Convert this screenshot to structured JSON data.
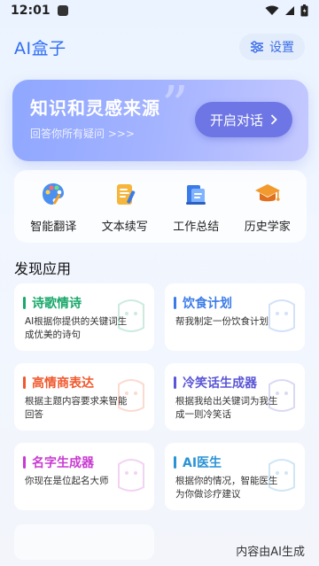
{
  "status_bar": {
    "time": "12:01"
  },
  "header": {
    "title": "AI盒子",
    "settings_label": "设置"
  },
  "hero": {
    "title": "知识和灵感来源",
    "subtitle": "回答你所有疑问 >>>",
    "quote_mark": "”",
    "button_label": "开启对话"
  },
  "features": [
    {
      "label": "智能翻译",
      "icon": "palette-icon"
    },
    {
      "label": "文本续写",
      "icon": "notepad-icon"
    },
    {
      "label": "工作总结",
      "icon": "document-icon"
    },
    {
      "label": "历史学家",
      "icon": "graduation-cap-icon"
    }
  ],
  "section_title": "发现应用",
  "apps": [
    {
      "title": "诗歌情诗",
      "desc": "AI根据你提供的关键词生成优美的诗句",
      "color": "#1aa86b"
    },
    {
      "title": "饮食计划",
      "desc": "帮我制定一份饮食计划",
      "color": "#3a7be8"
    },
    {
      "title": "高情商表达",
      "desc": "根据主题内容要求来智能回答",
      "color": "#f0592e"
    },
    {
      "title": "冷笑话生成器",
      "desc": "根据我给出关键词为我生成一则冷笑话",
      "color": "#5a56d6"
    },
    {
      "title": "名字生成器",
      "desc": "你现在是位起名大师",
      "color": "#c83bd1"
    },
    {
      "title": "AI医生",
      "desc": "根据你的情况，智能医生为你做诊疗建议",
      "color": "#2a93d6"
    }
  ],
  "footer": {
    "watermark": "内容由AI生成"
  }
}
